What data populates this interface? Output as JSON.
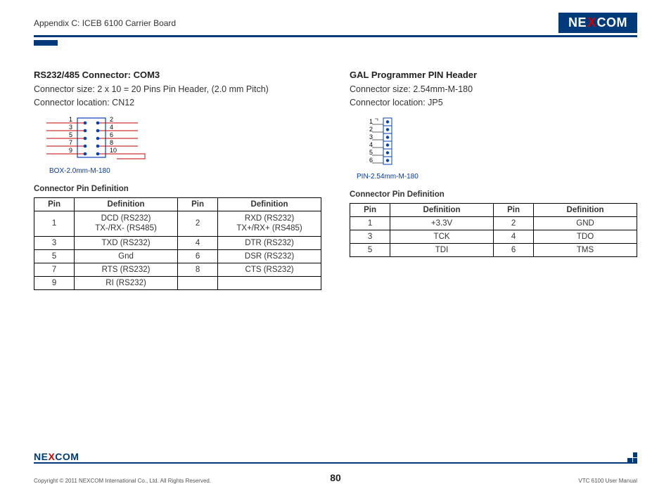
{
  "header": {
    "appendix": "Appendix C: ICEB 6100 Carrier Board",
    "logo": {
      "pre": "NE",
      "x": "X",
      "post": "COM"
    }
  },
  "left": {
    "title": "RS232/485 Connector: COM3",
    "size": "Connector size: 2 x 10 = 20 Pins Pin Header, (2.0 mm Pitch)",
    "location": "Connector location: CN12",
    "caption": "BOX-2.0mm-M-180",
    "subhead": "Connector Pin Definition",
    "th": {
      "pin": "Pin",
      "def": "Definition"
    },
    "rows": [
      {
        "p1": "1",
        "d1a": "DCD (RS232)",
        "d1b": "TX-/RX- (RS485)",
        "p2": "2",
        "d2a": "RXD (RS232)",
        "d2b": "TX+/RX+ (RS485)"
      },
      {
        "p1": "3",
        "d1a": "TXD (RS232)",
        "p2": "4",
        "d2a": "DTR (RS232)"
      },
      {
        "p1": "5",
        "d1a": "Gnd",
        "p2": "6",
        "d2a": "DSR (RS232)"
      },
      {
        "p1": "7",
        "d1a": "RTS (RS232)",
        "p2": "8",
        "d2a": "CTS (RS232)"
      },
      {
        "p1": "9",
        "d1a": "RI (RS232)",
        "p2": "",
        "d2a": ""
      }
    ],
    "diagram": {
      "left_labels": [
        "1",
        "3",
        "5",
        "7",
        "9"
      ],
      "right_labels": [
        "2",
        "4",
        "6",
        "8",
        "10"
      ]
    }
  },
  "right": {
    "title": "GAL Programmer PIN Header",
    "size": "Connector size: 2.54mm-M-180",
    "location": "Connector location: JP5",
    "caption": "PIN-2.54mm-M-180",
    "subhead": "Connector Pin Definition",
    "th": {
      "pin": "Pin",
      "def": "Definition"
    },
    "rows": [
      {
        "p1": "1",
        "d1": "+3.3V",
        "p2": "2",
        "d2": "GND"
      },
      {
        "p1": "3",
        "d1": "TCK",
        "p2": "4",
        "d2": "TDO"
      },
      {
        "p1": "5",
        "d1": "TDI",
        "p2": "6",
        "d2": "TMS"
      }
    ],
    "diagram": {
      "labels": [
        "1",
        "2",
        "3",
        "4",
        "5",
        "6"
      ]
    }
  },
  "footer": {
    "logo": {
      "pre": "NE",
      "x": "X",
      "post": "COM"
    },
    "copyright": "Copyright © 2011 NEXCOM International Co., Ltd. All Rights Reserved.",
    "page": "80",
    "doc": "VTC 6100 User Manual"
  }
}
